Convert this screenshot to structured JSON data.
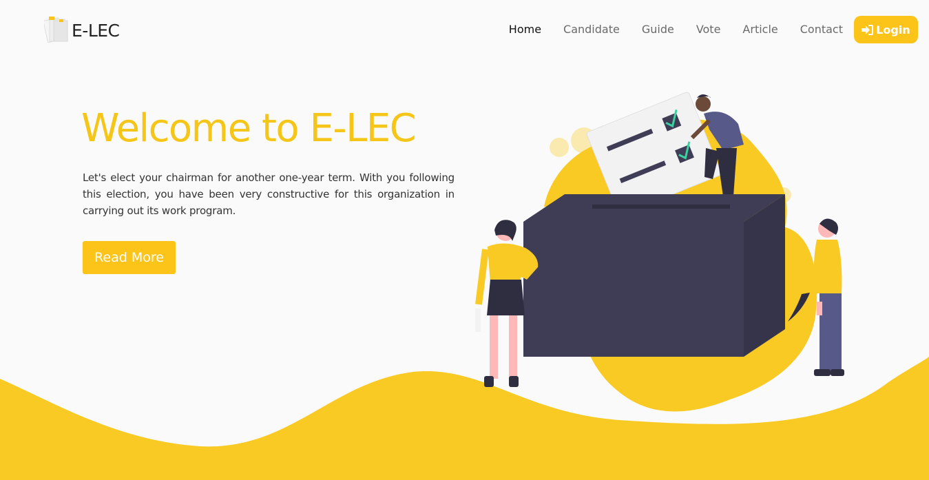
{
  "header": {
    "brand": {
      "name": "E-LEC",
      "logo_icon": "ballot-papers-icon"
    },
    "nav": {
      "items": [
        {
          "label": "Home",
          "active": true
        },
        {
          "label": "Candidate",
          "active": false
        },
        {
          "label": "Guide",
          "active": false
        },
        {
          "label": "Vote",
          "active": false
        },
        {
          "label": "Article",
          "active": false
        },
        {
          "label": "Contact",
          "active": false
        }
      ],
      "login": {
        "label": "Login",
        "icon": "sign-in-icon"
      }
    }
  },
  "hero": {
    "title": "Welcome to E-LEC",
    "description": "Let's elect your chairman for another one-year term. With you following this election, you have been very constructive for this organization in carrying out its work program.",
    "cta_label": "Read More",
    "illustration": "voting-ballot-box-illustration"
  },
  "colors": {
    "accent": "#fcc419",
    "title": "#f5c518",
    "wave": "#f9ca24",
    "ballot_box": "#3f3d56",
    "background": "#fafafa",
    "text": "#333333"
  }
}
